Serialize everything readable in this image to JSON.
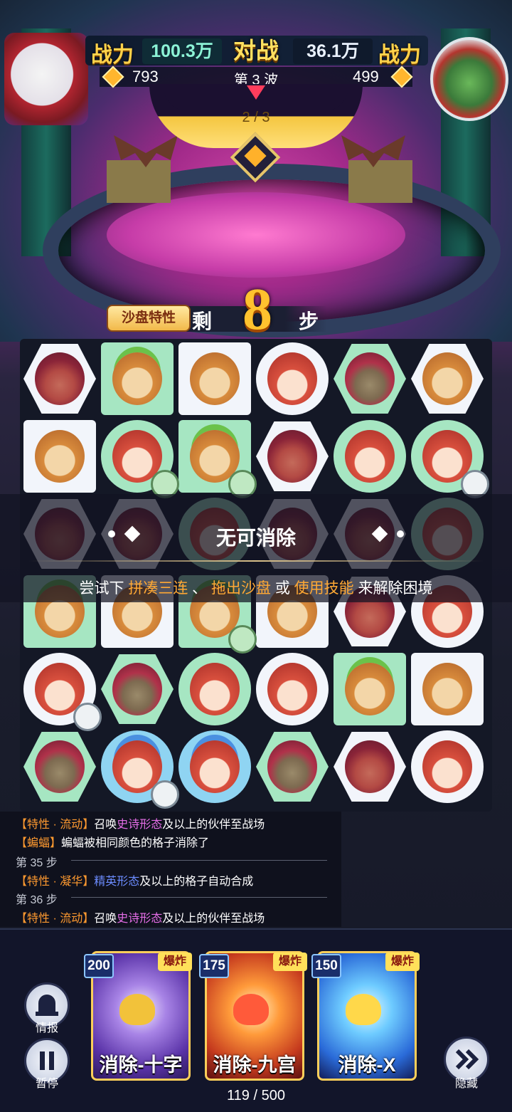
{
  "hud": {
    "power_label_left": "战力",
    "power_value_left": "100.3万",
    "vs_label": "对战",
    "power_value_right": "36.1万",
    "power_label_right": "战力",
    "gold_left": "793",
    "wave_label": "第 3 波",
    "gold_right": "499",
    "wave_progress": "2 / 3"
  },
  "steps": {
    "feature_button": "沙盘特性",
    "prefix": "剩",
    "count": "8",
    "suffix": "步"
  },
  "board": {
    "rows": [
      [
        [
          "ox",
          "white",
          "hex"
        ],
        [
          "monkey-g",
          "green",
          "square"
        ],
        [
          "monkey",
          "white",
          "square"
        ],
        [
          "girl",
          "white",
          "circle"
        ],
        [
          "ox-g",
          "green",
          "hex"
        ],
        [
          "monkey",
          "white",
          "hex"
        ]
      ],
      [
        [
          "monkey",
          "white",
          "square"
        ],
        [
          "girl",
          "green",
          "circle"
        ],
        [
          "monkey-g",
          "green",
          "square"
        ],
        [
          "ox",
          "white",
          "hex"
        ],
        [
          "girl",
          "green",
          "circle"
        ],
        [
          "girl",
          "green",
          "circle"
        ]
      ],
      [
        [
          "ox",
          "white",
          "hex"
        ],
        [
          "ox",
          "white",
          "hex"
        ],
        [
          "girl",
          "green",
          "circle"
        ],
        [
          "ox",
          "white",
          "hex"
        ],
        [
          "ox",
          "white",
          "hex"
        ],
        [
          "girl",
          "green",
          "circle"
        ]
      ],
      [
        [
          "monkey-g",
          "green",
          "square"
        ],
        [
          "monkey",
          "white",
          "square"
        ],
        [
          "monkey-g",
          "green",
          "square"
        ],
        [
          "monkey",
          "white",
          "square"
        ],
        [
          "ox",
          "white",
          "hex"
        ],
        [
          "girl",
          "white",
          "circle"
        ]
      ],
      [
        [
          "girl",
          "white",
          "circle"
        ],
        [
          "ox-g",
          "green",
          "hex"
        ],
        [
          "girl",
          "green",
          "circle"
        ],
        [
          "girl",
          "white",
          "circle"
        ],
        [
          "monkey-g",
          "green",
          "square"
        ],
        [
          "monkey",
          "white",
          "square"
        ]
      ],
      [
        [
          "ox-g",
          "green",
          "hex"
        ],
        [
          "girl-b",
          "blue",
          "circle"
        ],
        [
          "girl-b",
          "blue",
          "circle"
        ],
        [
          "ox-g",
          "green",
          "hex"
        ],
        [
          "ox",
          "white",
          "hex"
        ],
        [
          "girl",
          "white",
          "circle"
        ]
      ]
    ]
  },
  "overlay": {
    "title": "无可消除",
    "hint_prefix": "尝试下 ",
    "hint_opt1": "拼凑三连",
    "hint_sep": " 、 ",
    "hint_opt2": "拖出沙盘",
    "hint_or": " 或 ",
    "hint_opt3": "使用技能",
    "hint_suffix": " 来解除困境"
  },
  "log": {
    "line1_tag": "【特性 · 流动】",
    "line1_pre": "召唤",
    "line1_hl": "史诗形态",
    "line1_post": "及以上的伙伴至战场",
    "line2_tag": "【蝙蝠】",
    "line2_text": "蝙蝠被相同颜色的格子消除了",
    "step35": "第 35 步",
    "line3_tag": "【特性 · 凝华】",
    "line3_hl": "精英形态",
    "line3_post": "及以上的格子自动合成",
    "step36": "第 36 步",
    "line4_tag": "【特性 · 流动】",
    "line4_pre": "召唤",
    "line4_hl": "史诗形态",
    "line4_post": "及以上的伙伴至战场"
  },
  "controls": {
    "info_label": "情报",
    "pause_label": "暂停",
    "hide_label": "隐藏"
  },
  "skills": [
    {
      "cost": "200",
      "tag": "爆炸",
      "name": "消除-十字"
    },
    {
      "cost": "175",
      "tag": "爆炸",
      "name": "消除-九宫"
    },
    {
      "cost": "150",
      "tag": "爆炸",
      "name": "消除-X"
    }
  ],
  "energy": "119 / 500",
  "colors": {
    "power_gold": "#ffd24a",
    "highlight_orange": "#ffa834",
    "epic_purple": "#e66ee8",
    "elite_blue": "#6c8cff"
  }
}
